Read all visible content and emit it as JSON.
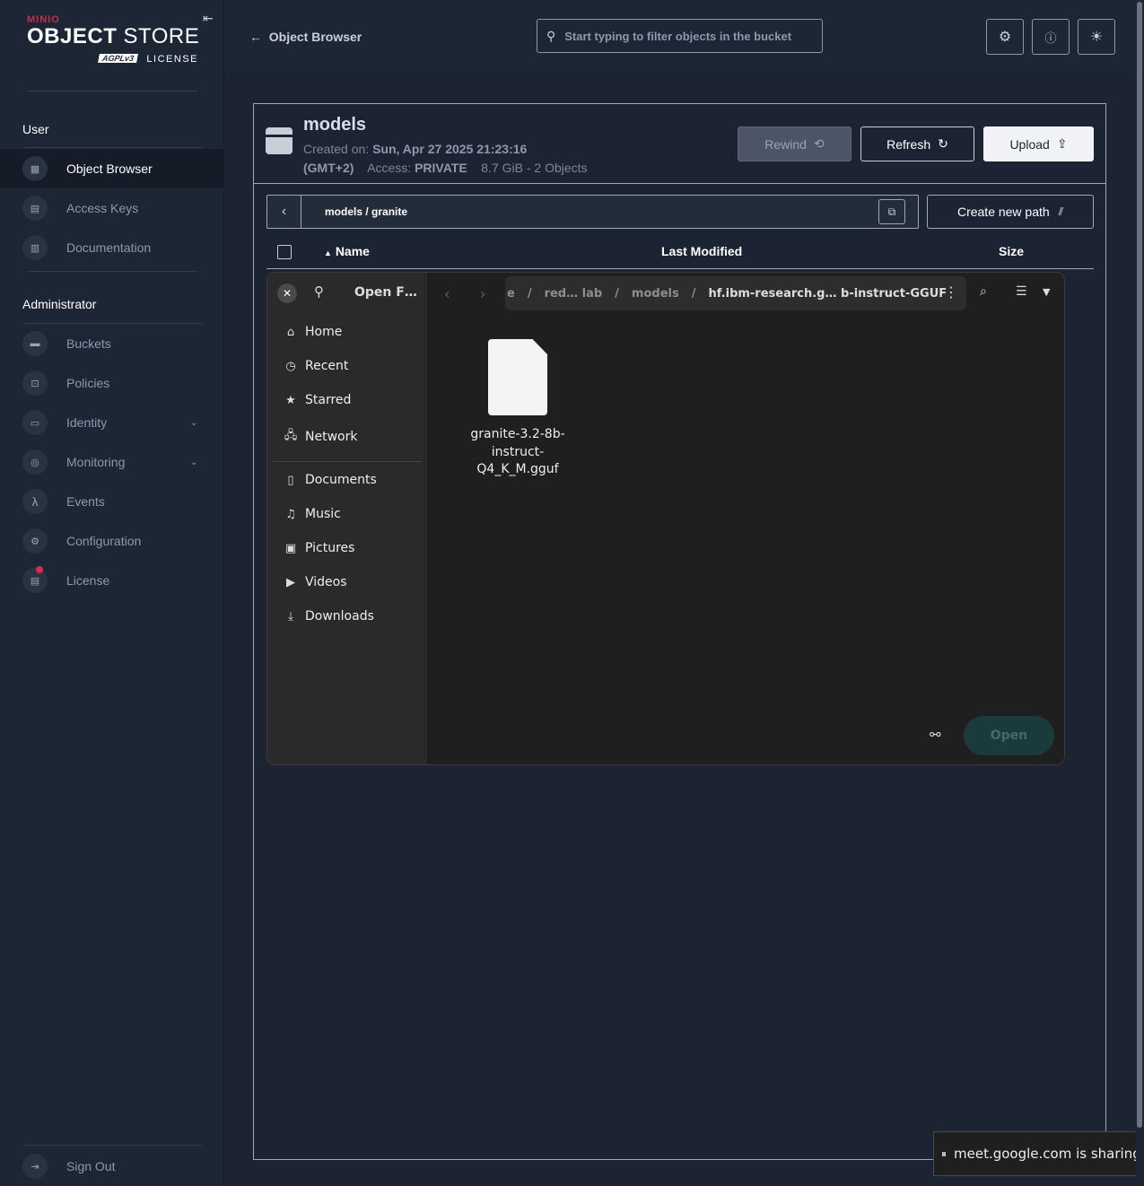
{
  "brand": {
    "minio": "MINIO",
    "title_light": "OBJECT",
    "title_bold": "STORE",
    "agpl": "AGPLv3",
    "license": "LICENSE"
  },
  "sidebar": {
    "user_section": "User",
    "user_items": [
      {
        "label": "Object Browser",
        "icon": "object-browser-icon"
      },
      {
        "label": "Access Keys",
        "icon": "key-icon"
      },
      {
        "label": "Documentation",
        "icon": "docs-icon"
      }
    ],
    "admin_section": "Administrator",
    "admin_items": [
      {
        "label": "Buckets",
        "icon": "bucket-icon"
      },
      {
        "label": "Policies",
        "icon": "lock-icon"
      },
      {
        "label": "Identity",
        "icon": "identity-icon"
      },
      {
        "label": "Monitoring",
        "icon": "monitor-icon"
      },
      {
        "label": "Events",
        "icon": "lambda-icon"
      },
      {
        "label": "Configuration",
        "icon": "gear-icon"
      },
      {
        "label": "License",
        "icon": "license-icon"
      }
    ],
    "signout": "Sign Out"
  },
  "topbar": {
    "back_label": "Object Browser",
    "search_placeholder": "Start typing to filter objects in the bucket"
  },
  "bucket": {
    "name": "models",
    "created_label": "Created on:",
    "created_value": "Sun, Apr 27 2025 21:23:16",
    "tz": "(GMT+2)",
    "access_label": "Access:",
    "access_value": "PRIVATE",
    "size": "8.7 GiB - 2 Objects",
    "rewind": "Rewind",
    "refresh": "Refresh",
    "upload": "Upload"
  },
  "browser": {
    "path": "models / granite",
    "new_path": "Create new path",
    "col_name": "Name",
    "col_modified": "Last Modified",
    "col_size": "Size"
  },
  "dialog": {
    "title": "Open F…",
    "path": [
      "e",
      "red… lab",
      "models",
      "hf.ibm-research.g… b-instruct-GGUF"
    ],
    "places": [
      {
        "label": "Home",
        "icon": "home-icon",
        "glyph": "⌂"
      },
      {
        "label": "Recent",
        "icon": "clock-icon",
        "glyph": "◷"
      },
      {
        "label": "Starred",
        "icon": "star-icon",
        "glyph": "★"
      },
      {
        "label": "Network",
        "icon": "network-icon",
        "glyph": "🖧"
      }
    ],
    "folders": [
      {
        "label": "Documents",
        "icon": "document-icon",
        "glyph": "▯"
      },
      {
        "label": "Music",
        "icon": "music-icon",
        "glyph": "♫"
      },
      {
        "label": "Pictures",
        "icon": "picture-icon",
        "glyph": "▣"
      },
      {
        "label": "Videos",
        "icon": "video-icon",
        "glyph": "▶"
      },
      {
        "label": "Downloads",
        "icon": "download-icon",
        "glyph": "⤓"
      }
    ],
    "file_line1": "granite-3.2-8b-",
    "file_line2": "instruct-",
    "file_line3": "Q4_K_M.gguf",
    "open": "Open"
  },
  "share_bar": "meet.google.com is sharing your screen"
}
